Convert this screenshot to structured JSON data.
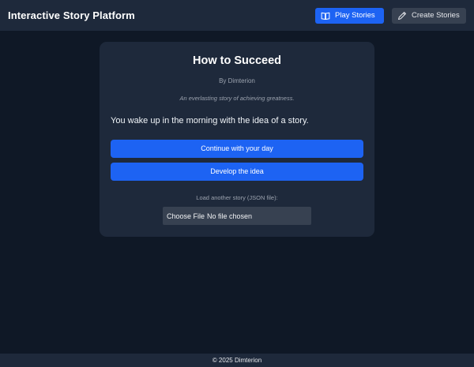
{
  "header": {
    "title": "Interactive Story Platform",
    "nav": {
      "play_label": "Play Stories",
      "create_label": "Create Stories"
    }
  },
  "story": {
    "title": "How to Succeed",
    "author": "By Dimterion",
    "description": "An everlasting story of achieving greatness.",
    "scene_text": "You wake up in the morning with the idea of a story.",
    "choices": [
      {
        "label": "Continue with your day"
      },
      {
        "label": "Develop the idea"
      }
    ]
  },
  "loader": {
    "label": "Load another story (JSON file):",
    "button_label": "Choose File",
    "status": "No file chosen"
  },
  "footer": {
    "text": "© 2025 Dimterion"
  },
  "colors": {
    "background": "#0f1826",
    "surface": "#1e293b",
    "accent": "#1d63f3",
    "muted_button": "#374151"
  },
  "icons": {
    "play": "book-open-icon",
    "create": "pencil-icon"
  }
}
